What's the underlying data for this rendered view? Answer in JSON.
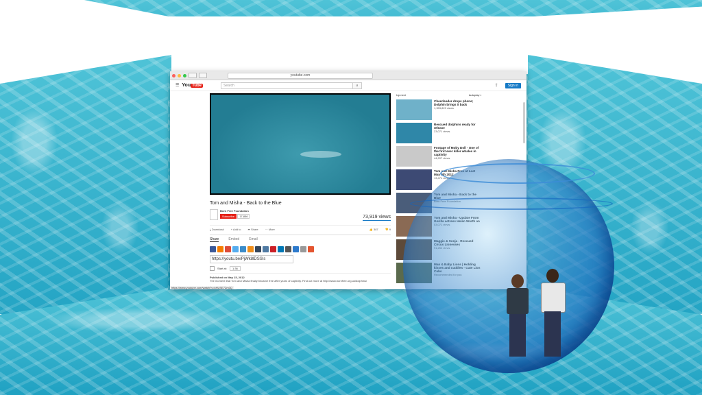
{
  "browser": {
    "url": "youtube.com",
    "search_placeholder": "Search",
    "sign_in": "Sign in",
    "logo": {
      "you": "You",
      "tube": "Tube"
    }
  },
  "video": {
    "title": "Tom and Misha - Back to the Blue",
    "channel": "Born Free Foundation",
    "subscribe_label": "Subscribe",
    "subscriber_count": "17,856",
    "views": "73,919 views",
    "likes": "387",
    "dislikes": "9",
    "actions": {
      "download": "Download",
      "add_to": "Add to",
      "share": "Share",
      "more": "More"
    },
    "share_tabs": [
      "Share",
      "Embed",
      "Email"
    ],
    "share_url": "https://youtu.be/PjWk8lDSSIs",
    "start_at_label": "Start at:",
    "start_at_value": "1:36",
    "published": "Published on May 15, 2012",
    "description": "The moment that Tom and Misha finally became free after years of captivity. Find out more at http://www.bornfree.org.uk/dolphins/"
  },
  "status_url": "https://www.youtube.com/watch?v=kHUSE7Zm3Q",
  "upnext": {
    "label": "Up next",
    "autoplay": "Autoplay",
    "items": [
      {
        "title": "Cheerleader drops phone; Dolphin brings it back",
        "meta": "1,353,823 views",
        "color": "#6fb1c9"
      },
      {
        "title": "Rescued dolphins ready for release",
        "meta": "23,071 views",
        "color": "#2f87a8"
      },
      {
        "title": "Footage of Moby Doll - One of the first ever killer whales in captivity",
        "meta": "44,207 views",
        "color": "#c9c9c9"
      },
      {
        "title": "Tom and Misha Free at Last May 9th 2012",
        "meta": "13,471 views",
        "color": "#3d4a74"
      },
      {
        "title": "Tom and Misha - Back to the Blue",
        "meta": "Born Free Foundation",
        "color": "#4a5d7a"
      },
      {
        "title": "Tom and Misha - Update From Gorilla actress Helen Worth an",
        "meta": "53,071 views",
        "color": "#8a6a54"
      },
      {
        "title": "Maggie & Sonja - Rescued Circus Lionesses",
        "meta": "91,252 views",
        "color": "#5d4a3a"
      },
      {
        "title": "Man & Baby Lions | Holding kisses and cuddles - Cute Lion Cubs",
        "meta": "Recommended for you",
        "color": "#5a6a4d"
      }
    ]
  },
  "colors": {
    "brand": "#e62117",
    "link": "#167ac6",
    "bowl": "#1e6ebe"
  }
}
